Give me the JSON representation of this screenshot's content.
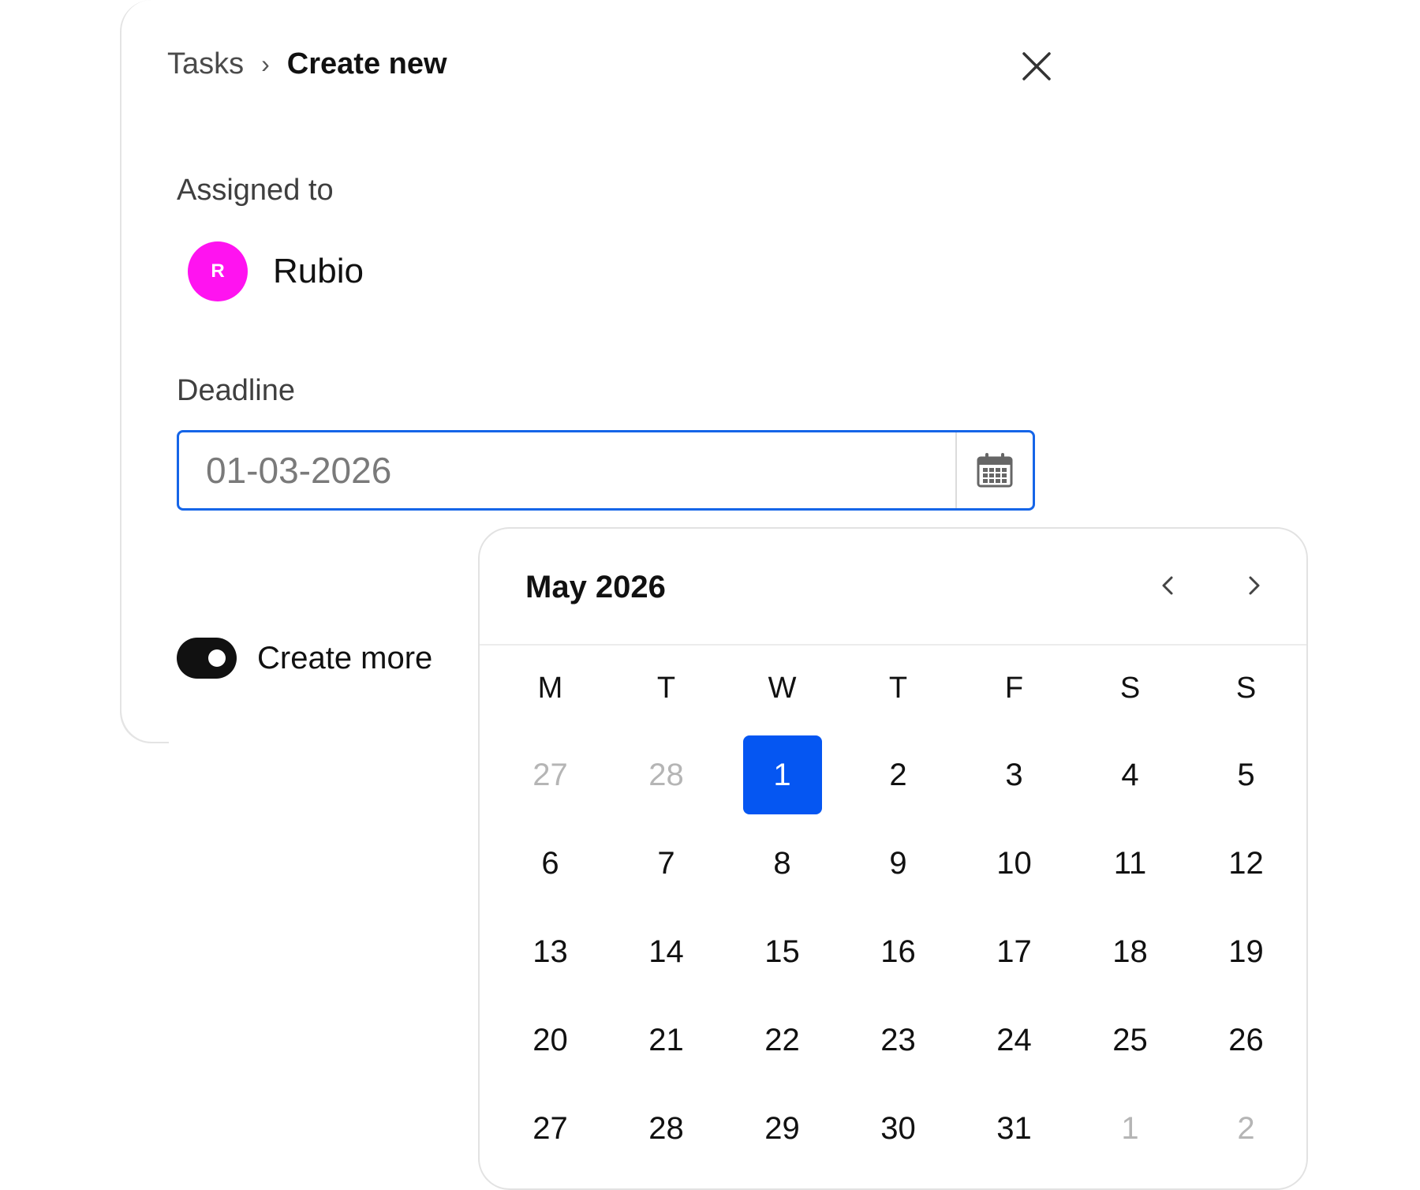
{
  "breadcrumb": {
    "parent": "Tasks",
    "separator": "›",
    "current": "Create new"
  },
  "assigned": {
    "label": "Assigned to",
    "initial": "R",
    "name": "Rubio",
    "avatar_color": "#ff13f0"
  },
  "deadline": {
    "label": "Deadline",
    "placeholder": "01-03-2026"
  },
  "create_more": {
    "label": "Create more",
    "enabled": true
  },
  "calendar": {
    "month_label": "May 2026",
    "weekdays": [
      "M",
      "T",
      "W",
      "T",
      "F",
      "S",
      "S"
    ],
    "days": [
      {
        "d": "27",
        "muted": true
      },
      {
        "d": "28",
        "muted": true
      },
      {
        "d": "1",
        "selected": true
      },
      {
        "d": "2"
      },
      {
        "d": "3"
      },
      {
        "d": "4"
      },
      {
        "d": "5"
      },
      {
        "d": "6"
      },
      {
        "d": "7"
      },
      {
        "d": "8"
      },
      {
        "d": "9"
      },
      {
        "d": "10"
      },
      {
        "d": "11"
      },
      {
        "d": "12"
      },
      {
        "d": "13"
      },
      {
        "d": "14"
      },
      {
        "d": "15"
      },
      {
        "d": "16"
      },
      {
        "d": "17"
      },
      {
        "d": "18"
      },
      {
        "d": "19"
      },
      {
        "d": "20"
      },
      {
        "d": "21"
      },
      {
        "d": "22"
      },
      {
        "d": "23"
      },
      {
        "d": "24"
      },
      {
        "d": "25"
      },
      {
        "d": "26"
      },
      {
        "d": "27"
      },
      {
        "d": "28"
      },
      {
        "d": "29"
      },
      {
        "d": "30"
      },
      {
        "d": "31"
      },
      {
        "d": "1",
        "muted": true
      },
      {
        "d": "2",
        "muted": true
      }
    ]
  },
  "colors": {
    "accent": "#1565e8",
    "selected_day": "#0556f2",
    "toggle_on": "#111111"
  }
}
